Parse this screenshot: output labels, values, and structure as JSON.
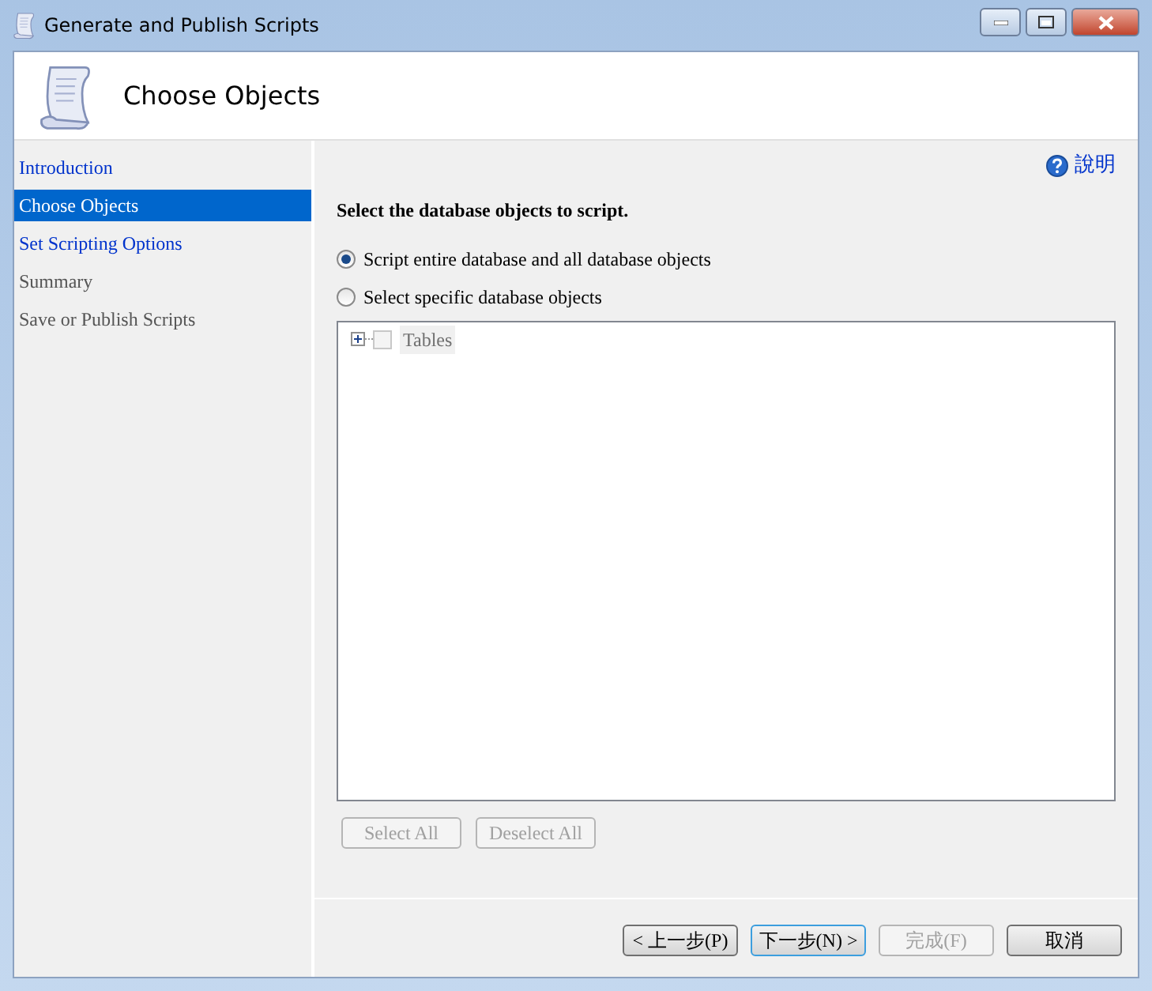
{
  "window": {
    "title": "Generate and Publish Scripts"
  },
  "header": {
    "title": "Choose Objects"
  },
  "sidebar": {
    "items": [
      {
        "label": "Introduction",
        "selected": false,
        "disabled": false
      },
      {
        "label": "Choose Objects",
        "selected": true,
        "disabled": false
      },
      {
        "label": "Set Scripting Options",
        "selected": false,
        "disabled": false
      },
      {
        "label": "Summary",
        "selected": false,
        "disabled": true
      },
      {
        "label": "Save or Publish Scripts",
        "selected": false,
        "disabled": true
      }
    ]
  },
  "help_link": "說明",
  "heading": "Select the database objects to script.",
  "options": [
    {
      "label": "Script entire database and all database objects",
      "selected": true
    },
    {
      "label": "Select specific database objects",
      "selected": false
    }
  ],
  "tree": {
    "items": [
      {
        "label": "Tables",
        "expanded": false,
        "checked": false,
        "disabled": true
      }
    ]
  },
  "tree_buttons": [
    {
      "label": "Select All",
      "disabled": true
    },
    {
      "label": "Deselect All",
      "disabled": true
    }
  ],
  "footer_buttons": [
    {
      "label": "< 上一步(P)",
      "disabled": false,
      "default": false
    },
    {
      "label": "下一步(N) >",
      "disabled": false,
      "default": true
    },
    {
      "label": "完成(F)",
      "disabled": true,
      "default": false
    },
    {
      "label": "取消",
      "disabled": false,
      "default": false
    }
  ]
}
